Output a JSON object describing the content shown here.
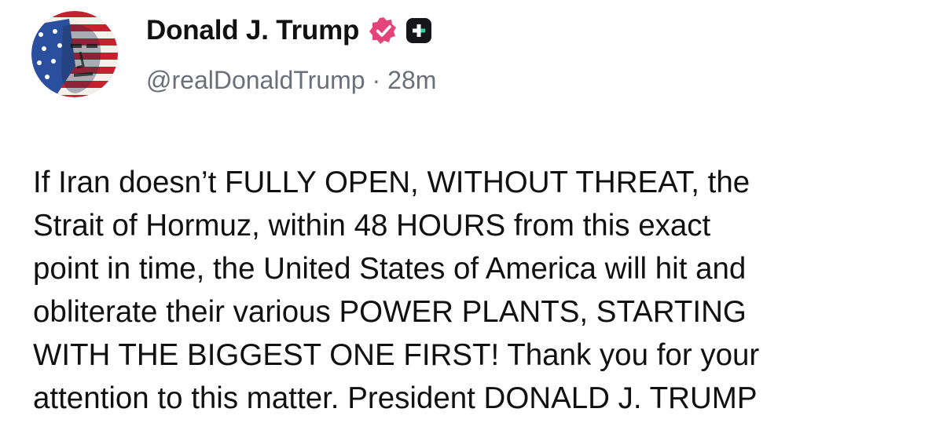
{
  "author": {
    "display_name": "Donald J. Trump",
    "handle": "@realDonaldTrump",
    "separator": "·",
    "timestamp": "28m",
    "avatar_icon": "flag-portrait-avatar",
    "verified_icon": "verified-badge-icon",
    "verified_color": "#e3457a",
    "plus_icon": "plus-badge-icon",
    "plus_color": "#16161a"
  },
  "post": {
    "lines": [
      "If Iran doesn’t FULLY OPEN, WITHOUT THREAT, the",
      "Strait of Hormuz, within 48 HOURS from this exact",
      "point in time, the United States of America will hit and",
      "obliterate their various POWER PLANTS, STARTING",
      "WITH THE BIGGEST ONE FIRST! Thank you for your",
      "attention to this matter. President DONALD J. TRUMP"
    ]
  }
}
